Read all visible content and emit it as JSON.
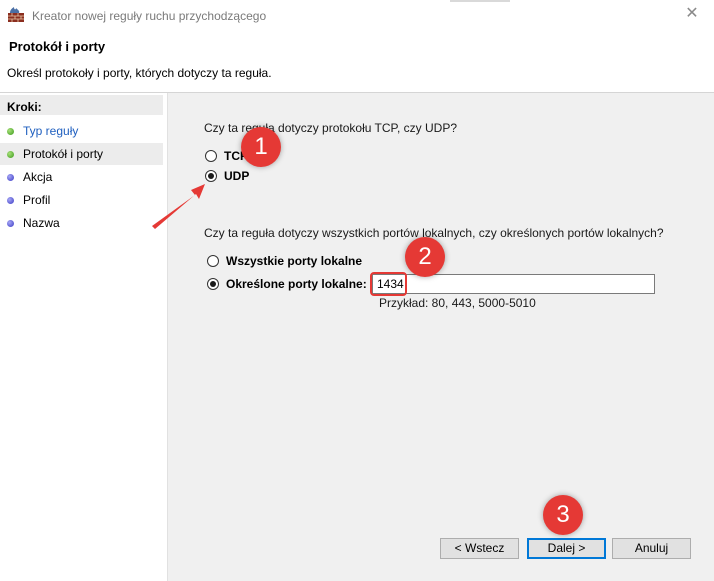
{
  "window": {
    "title": "Kreator nowej reguły ruchu przychodzącego"
  },
  "header": {
    "title": "Protokół i porty",
    "description": "Określ protokoły i porty, których dotyczy ta reguła."
  },
  "steps": {
    "title": "Kroki:",
    "items": [
      {
        "label": "Typ reguły",
        "status": "done"
      },
      {
        "label": "Protokół i porty",
        "status": "current"
      },
      {
        "label": "Akcja",
        "status": "pending"
      },
      {
        "label": "Profil",
        "status": "pending"
      },
      {
        "label": "Nazwa",
        "status": "pending"
      }
    ]
  },
  "protocol": {
    "question": "Czy ta reguła dotyczy protokołu TCP, czy UDP?",
    "options": [
      {
        "label": "TCP",
        "selected": false
      },
      {
        "label": "UDP",
        "selected": true
      }
    ]
  },
  "ports": {
    "question": "Czy ta reguła dotyczy wszystkich portów lokalnych, czy określonych portów lokalnych?",
    "options": [
      {
        "label": "Wszystkie porty lokalne",
        "selected": false
      },
      {
        "label": "Określone porty lokalne:",
        "selected": true
      }
    ],
    "value": "1434",
    "hint": "Przykład: 80, 443, 5000-5010"
  },
  "buttons": {
    "back": "< Wstecz",
    "next": "Dalej >",
    "cancel": "Anuluj"
  },
  "annotations": {
    "badge1": "1",
    "badge2": "2",
    "badge3": "3"
  },
  "colors": {
    "accent": "#e53935",
    "link": "#1f5fbf",
    "focus": "#0078d7"
  },
  "icons": {
    "app": "firewall-wall-icon",
    "close": "close-icon"
  }
}
